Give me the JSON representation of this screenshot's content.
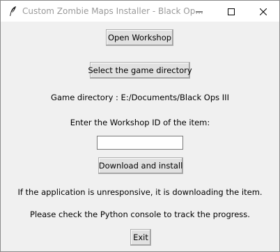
{
  "window": {
    "title": "Custom Zombie Maps Installer - Black Op...",
    "controls": {
      "minimize_icon": "minimize-icon",
      "maximize_icon": "maximize-icon",
      "close_icon": "close-icon"
    },
    "app_icon": "feather-icon"
  },
  "main": {
    "open_workshop_label": "Open Workshop",
    "select_directory_label": "Select the game directory",
    "game_directory_text": "Game directory : E:/Documents/Black Ops III",
    "workshop_id_prompt": "Enter the Workshop ID of the item:",
    "workshop_id_value": "",
    "download_label": "Download and install",
    "unresponsive_note": "If the application is unresponsive, it is downloading the item.",
    "console_note": "Please check the Python console to track the progress.",
    "exit_label": "Exit"
  },
  "colors": {
    "window_bg": "#f0f0f0",
    "titlebar_bg": "#ffffff",
    "title_text": "#999999",
    "button_bg": "#e1e1e1"
  }
}
